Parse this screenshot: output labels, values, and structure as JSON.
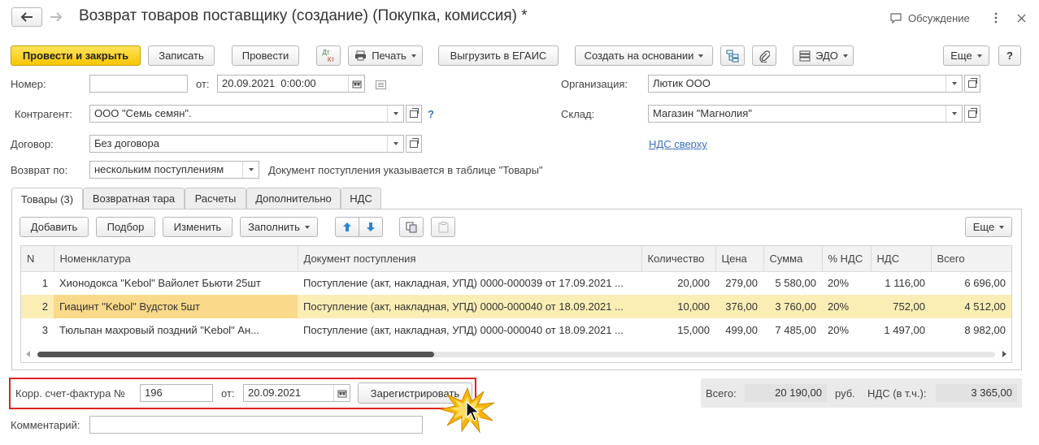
{
  "window": {
    "title": "Возврат товаров поставщику (создание) (Покупка, комиссия) *",
    "discussion": "Обсуждение"
  },
  "toolbar": {
    "post_close": "Провести и закрыть",
    "save": "Записать",
    "post": "Провести",
    "dt_kt_top": "Дт",
    "dt_kt_bottom": "Кт",
    "print": "Печать",
    "egais": "Выгрузить в ЕГАИС",
    "create_based": "Создать на основании",
    "edo": "ЭДО",
    "more": "Еще",
    "help": "?"
  },
  "form": {
    "number_label": "Номер:",
    "number_value": "",
    "date_label": "от:",
    "date_value": "20.09.2021  0:00:00",
    "org_label": "Организация:",
    "org_value": "Лютик ООО",
    "contractor_label": "Контрагент:",
    "contractor_value": "ООО \"Семь семян\".",
    "contractor_help": "?",
    "warehouse_label": "Склад:",
    "warehouse_value": "Магазин \"Магнолия\"",
    "contract_label": "Договор:",
    "contract_value": "Без договора",
    "vat_link": "НДС сверху",
    "return_by_label": "Возврат по:",
    "return_by_value": "нескольким поступлениям",
    "return_by_note": "Документ поступления указывается в таблице \"Товары\""
  },
  "tabs": [
    {
      "label": "Товары (3)"
    },
    {
      "label": "Возвратная тара"
    },
    {
      "label": "Расчеты"
    },
    {
      "label": "Дополнительно"
    },
    {
      "label": "НДС"
    }
  ],
  "table_toolbar": {
    "add": "Добавить",
    "pick": "Подбор",
    "edit": "Изменить",
    "fill": "Заполнить",
    "more": "Еще"
  },
  "table": {
    "headers": {
      "n": "N",
      "item": "Номенклатура",
      "doc": "Документ поступления",
      "qty": "Количество",
      "price": "Цена",
      "sum": "Сумма",
      "vat_pct": "% НДС",
      "vat": "НДС",
      "total": "Всего"
    },
    "rows": [
      {
        "n": "1",
        "item": "Хионодокса \"Kebol\" Вайолет Бьюти 25шт",
        "doc": "Поступление (акт, накладная, УПД) 0000-000039 от 17.09.2021 ...",
        "qty": "20,000",
        "price": "279,00",
        "sum": "5 580,00",
        "vat_pct": "20%",
        "vat": "1 116,00",
        "total": "6 696,00"
      },
      {
        "n": "2",
        "item": "Гиацинт \"Kebol\" Вудсток 5шт",
        "doc": "Поступление (акт, накладная, УПД) 0000-000040 от 18.09.2021 ...",
        "qty": "10,000",
        "price": "376,00",
        "sum": "3 760,00",
        "vat_pct": "20%",
        "vat": "752,00",
        "total": "4 512,00"
      },
      {
        "n": "3",
        "item": "Тюльпан махровый поздний \"Kebol\" Ан...",
        "doc": "Поступление (акт, накладная, УПД) 0000-000040 от 18.09.2021 ...",
        "qty": "15,000",
        "price": "499,00",
        "sum": "7 485,00",
        "vat_pct": "20%",
        "vat": "1 497,00",
        "total": "8 982,00"
      }
    ]
  },
  "invoice": {
    "label": "Корр. счет-фактура №",
    "number": "196",
    "date_label": "от:",
    "date": "20.09.2021",
    "register_button": "Зарегистрировать"
  },
  "totals": {
    "total_label": "Всего:",
    "total_value": "20 190,00",
    "currency": "руб.",
    "vat_label": "НДС (в т.ч.):",
    "vat_value": "3 365,00"
  },
  "comment": {
    "label": "Комментарий:",
    "value": ""
  },
  "colors": {
    "primary_button": "#f7c600",
    "selected_row": "#fbeeb5",
    "highlight_frame": "#e02020",
    "link": "#3d6ebf"
  }
}
